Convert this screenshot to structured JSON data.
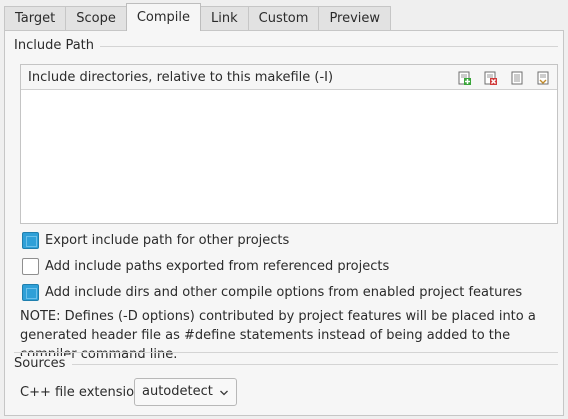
{
  "tabs": [
    {
      "label": "Target",
      "active": false
    },
    {
      "label": "Scope",
      "active": false
    },
    {
      "label": "Compile",
      "active": true
    },
    {
      "label": "Link",
      "active": false
    },
    {
      "label": "Custom",
      "active": false
    },
    {
      "label": "Preview",
      "active": false
    }
  ],
  "include_path": {
    "title": "Include Path",
    "list_header": "Include directories, relative to this makefile (-I)",
    "toolbar_icons": [
      "add-folder-icon",
      "remove-icon",
      "move-up-icon",
      "move-down-icon"
    ],
    "entries": []
  },
  "options": [
    {
      "label": "Export include path for other projects",
      "checked": true
    },
    {
      "label": "Add include paths exported from referenced projects",
      "checked": false
    },
    {
      "label": "Add include dirs and other compile options from enabled project features",
      "checked": true
    }
  ],
  "note": "NOTE: Defines (-D options) contributed by project features will be placed into a generated header file as #define statements instead of being added to the compiler command line.",
  "sources": {
    "title": "Sources",
    "extension_label": "C++ file extension:",
    "extension_value": "autodetect"
  },
  "colors": {
    "accent": "#2fa0d8",
    "panel_bg": "#f6f6f6",
    "window_bg": "#efefef"
  }
}
